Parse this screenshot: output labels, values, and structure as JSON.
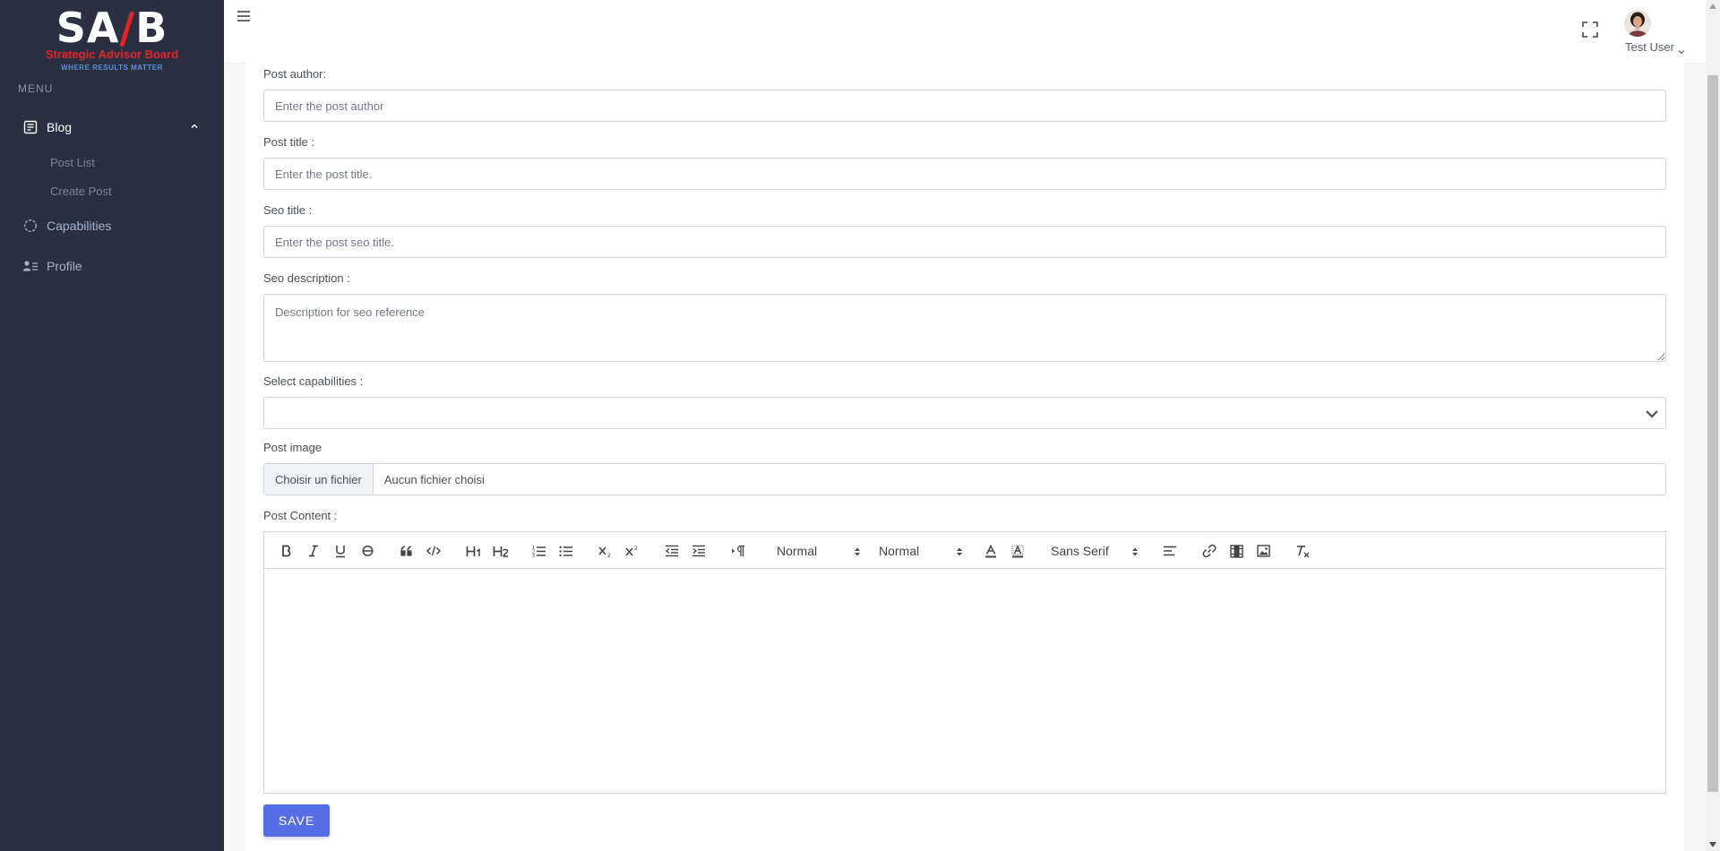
{
  "sidebar": {
    "logo": {
      "mark_left": "SA",
      "mark_accent": "/",
      "mark_right": "B",
      "subtitle": "Strategic Advisor Board",
      "tagline": "WHERE RESULTS MATTER"
    },
    "menu_title": "MENU",
    "items": [
      {
        "label": "Blog",
        "icon": "document-list-icon",
        "expanded": true,
        "children": [
          {
            "label": "Post List"
          },
          {
            "label": "Create Post"
          }
        ]
      },
      {
        "label": "Capabilities",
        "icon": "circle-dashed-icon"
      },
      {
        "label": "Profile",
        "icon": "user-list-icon"
      }
    ]
  },
  "header": {
    "user_name": "Test User"
  },
  "form": {
    "author": {
      "label": "Post author:",
      "placeholder": "Enter the post author"
    },
    "title": {
      "label": "Post title :",
      "placeholder": "Enter the post title."
    },
    "seo_title": {
      "label": "Seo title :",
      "placeholder": "Enter the post seo title."
    },
    "seo_description": {
      "label": "Seo description :",
      "placeholder": "Description for seo reference"
    },
    "capabilities": {
      "label": "Select capabilities :",
      "value": ""
    },
    "image": {
      "label": "Post image",
      "button": "Choisir un fichier",
      "file_name": "Aucun fichier choisi"
    },
    "content": {
      "label": "Post Content :",
      "toolbar": {
        "header_select": "Normal",
        "size_select": "Normal",
        "font_select": "Sans Serif"
      }
    },
    "save_label": "SAVE"
  },
  "colors": {
    "sidebar_bg": "#2a3042",
    "primary": "#556ee6",
    "brand_red": "#e32228",
    "brand_blue": "#5b8ed6"
  }
}
